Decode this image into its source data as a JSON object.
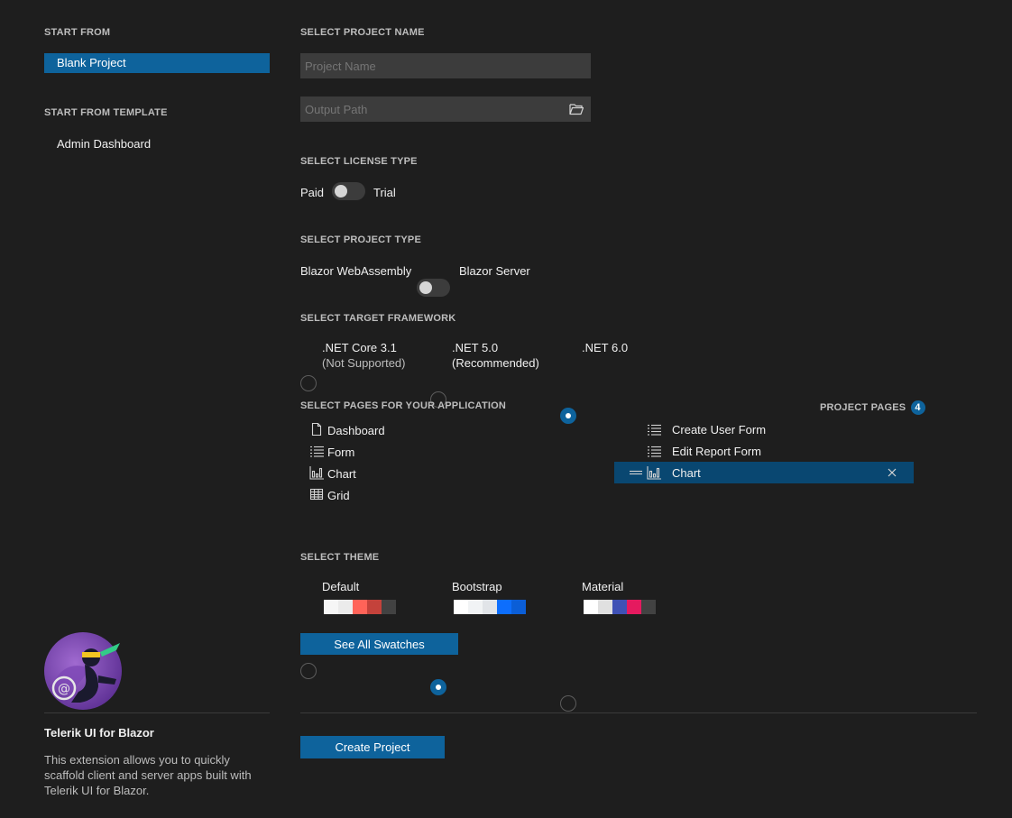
{
  "sidebar": {
    "start_from_heading": "START FROM",
    "blank_project": "Blank Project",
    "template_heading": "START FROM TEMPLATE",
    "template_item": "Admin Dashboard",
    "product_title": "Telerik UI for Blazor",
    "product_description": "This extension allows you to quickly scaffold client and server apps built with Telerik UI for Blazor."
  },
  "project_name": {
    "heading": "SELECT PROJECT NAME",
    "name_placeholder": "Project Name",
    "path_placeholder": "Output Path",
    "folder_icon": "folder-open-icon"
  },
  "license": {
    "heading": "SELECT LICENSE TYPE",
    "left_label": "Paid",
    "right_label": "Trial"
  },
  "project_type": {
    "heading": "SELECT PROJECT TYPE",
    "left_label": "Blazor WebAssembly",
    "right_label": "Blazor Server"
  },
  "framework": {
    "heading": "SELECT TARGET FRAMEWORK",
    "options": [
      {
        "label": ".NET Core 3.1",
        "sub": "(Not Supported)",
        "checked": false
      },
      {
        "label": ".NET 5.0",
        "sub": "(Recommended)",
        "checked": false
      },
      {
        "label": ".NET 6.0",
        "sub": "",
        "checked": true
      }
    ]
  },
  "pages": {
    "heading": "SELECT PAGES FOR YOUR APPLICATION",
    "available": [
      {
        "label": "Dashboard",
        "icon": "file-icon"
      },
      {
        "label": "Form",
        "icon": "list-icon"
      },
      {
        "label": "Chart",
        "icon": "bar-chart-icon"
      },
      {
        "label": "Grid",
        "icon": "grid-icon"
      }
    ],
    "project_heading": "PROJECT PAGES",
    "project_count": "4",
    "project": [
      {
        "label": "Create User Form",
        "icon": "list-icon",
        "selected": false
      },
      {
        "label": "Edit Report Form",
        "icon": "list-icon",
        "selected": false
      },
      {
        "label": "Chart",
        "icon": "bar-chart-icon",
        "selected": true
      }
    ]
  },
  "theme": {
    "heading": "SELECT THEME",
    "options": [
      {
        "label": "Default",
        "checked": false,
        "swatches": [
          "#f6f6f6",
          "#ebebeb",
          "#ff6358",
          "#c4423b",
          "#424242"
        ]
      },
      {
        "label": "Bootstrap",
        "checked": true,
        "swatches": [
          "#ffffff",
          "#f1f3f5",
          "#e1e4e8",
          "#0d6efd",
          "#0b5ed7"
        ]
      },
      {
        "label": "Material",
        "checked": false,
        "swatches": [
          "#ffffff",
          "#e0e0e0",
          "#3f51b5",
          "#e51a5f",
          "#424242"
        ]
      }
    ],
    "see_all": "See All Swatches"
  },
  "actions": {
    "create_project": "Create Project"
  },
  "colors": {
    "background": "#1e1e1e",
    "accent": "#0e639c",
    "selected_row": "#094771"
  }
}
